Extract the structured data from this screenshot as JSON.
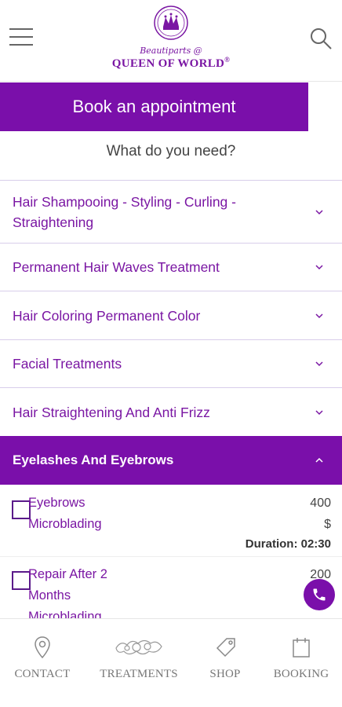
{
  "header": {
    "logo_script": "Beautiparts @",
    "logo_name": "QUEEN OF WORLD",
    "logo_mark": "®"
  },
  "book_button": "Book an appointment",
  "prompt": "What do you need?",
  "categories": [
    {
      "label": "Hair Shampooing - Styling - Curling - Straightening"
    },
    {
      "label": "Permanent Hair Waves Treatment"
    },
    {
      "label": "Hair Coloring Permanent Color"
    },
    {
      "label": "Facial Treatments"
    },
    {
      "label": "Hair Straightening And Anti Frizz"
    },
    {
      "label": "Eyelashes And Eyebrows"
    }
  ],
  "services": [
    {
      "name_line1": "Eyebrows",
      "name_line2": "Microblading",
      "price": "400",
      "currency": "$",
      "duration": "Duration: 02:30"
    },
    {
      "name_line1": "Repair After 2",
      "name_line2": "Months",
      "name_line3": "Microblading",
      "price": "200"
    }
  ],
  "bottom_nav": [
    {
      "label": "CONTACT",
      "icon": "location-pin-icon"
    },
    {
      "label": "TREATMENTS",
      "icon": "treatments-icon"
    },
    {
      "label": "SHOP",
      "icon": "tag-icon"
    },
    {
      "label": "BOOKING",
      "icon": "calendar-icon"
    }
  ],
  "colors": {
    "accent": "#7a0faa",
    "text_accent": "#7a16a3"
  }
}
